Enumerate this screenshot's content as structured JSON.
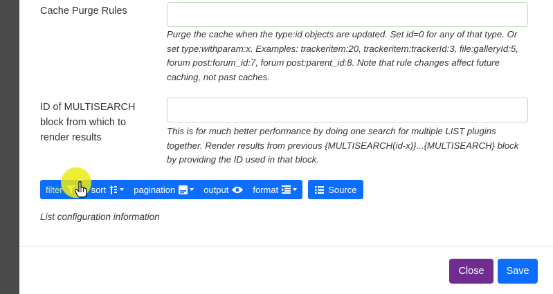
{
  "form": {
    "cache_purge": {
      "label": "Cache Purge Rules",
      "value": "",
      "help": "Purge the cache when the type:id objects are updated. Set id=0 for any of that type. Or set type:withparam:x. Examples: trackeritem:20, trackeritem:trackerId:3, file:galleryId:5, forum post:forum_id:7, forum post:parent_id:8. Note that rule changes affect future caching, not past caches."
    },
    "multisearch": {
      "label_lines": [
        "ID of MULTISEARCH",
        "block from which to",
        "render results"
      ],
      "value": "",
      "help": "This is for much better performance by doing one search for multiple LIST plugins together. Render results from previous {MULTISEARCH(id-x)}...{MULTISEARCH} block by providing the ID used in that block."
    }
  },
  "toolbar": {
    "filter_label": "filter",
    "sort_label": "sort",
    "pagination_label": "pagination",
    "output_label": "output",
    "format_label": "format",
    "source_label": "Source"
  },
  "list_info": "List configuration information",
  "footer": {
    "close_label": "Close",
    "save_label": "Save"
  },
  "colors": {
    "primary": "#0d6efd",
    "close_purple": "#6f2c91",
    "input_border": "#b9dfb5",
    "click_highlight": "#ebeb14"
  }
}
